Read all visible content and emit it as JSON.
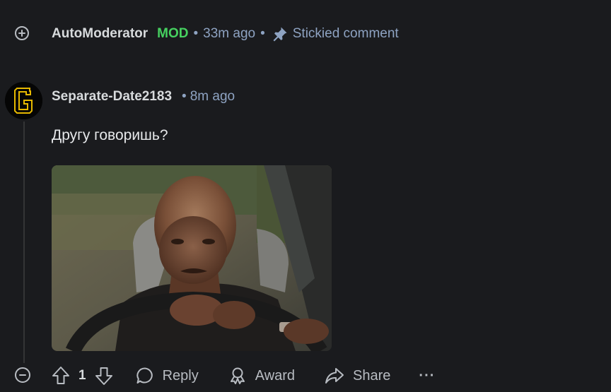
{
  "sticky_comment": {
    "author": "AutoModerator",
    "badge": "MOD",
    "time": "33m ago",
    "separator": "•",
    "status": "Stickied comment",
    "expand_icon": "plus-circle-icon",
    "pin_icon": "pin-icon"
  },
  "comment": {
    "author": "Separate-Date2183",
    "separator": "•",
    "time": "8m ago",
    "body": "Другу говоришь?",
    "avatar_letter": "G",
    "media": "gif of a man driving a car, glancing sideways"
  },
  "actions": {
    "score": "1",
    "reply_label": "Reply",
    "award_label": "Award",
    "share_label": "Share",
    "more_label": "···"
  },
  "colors": {
    "background": "#1a1b1e",
    "mod_green": "#46d160",
    "meta_blue": "#8ea3c2",
    "text": "#d7dadc",
    "avatar_gold": "#e6b800"
  }
}
